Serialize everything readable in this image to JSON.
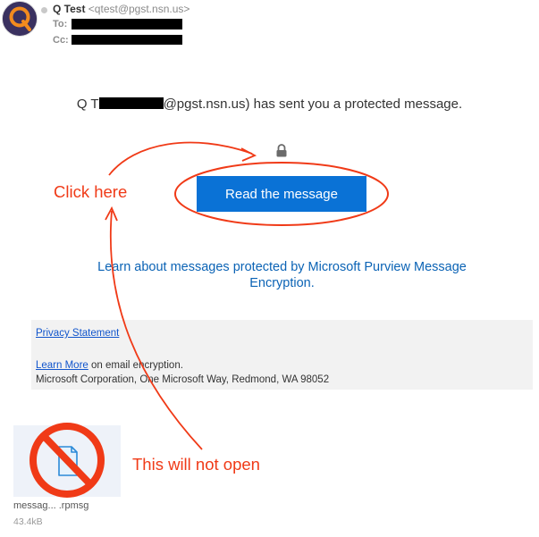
{
  "header": {
    "sender_name": "Q Test",
    "sender_email": "<qtest@pgst.nsn.us>",
    "to_label": "To:",
    "cc_label": "Cc:"
  },
  "body": {
    "sent_prefix": "Q T",
    "sent_suffix": "@pgst.nsn.us) has sent you a protected message.",
    "read_button": "Read the message",
    "learn_link": "Learn about messages protected by Microsoft Purview Message Encryption."
  },
  "footer": {
    "privacy_link": "Privacy Statement",
    "learn_more_link": "Learn More",
    "learn_more_suffix": " on email encryption.",
    "address": "Microsoft Corporation, One Microsoft Way, Redmond, WA 98052"
  },
  "attachment": {
    "name": "messag... .rpmsg",
    "size": "43.4kB"
  },
  "annotations": {
    "click_here": "Click here",
    "will_not_open": "This will not open",
    "color": "#f03a17"
  },
  "colors": {
    "button": "#0a72d6",
    "link": "#0b63b5",
    "footer_bg": "#f2f2f2"
  }
}
